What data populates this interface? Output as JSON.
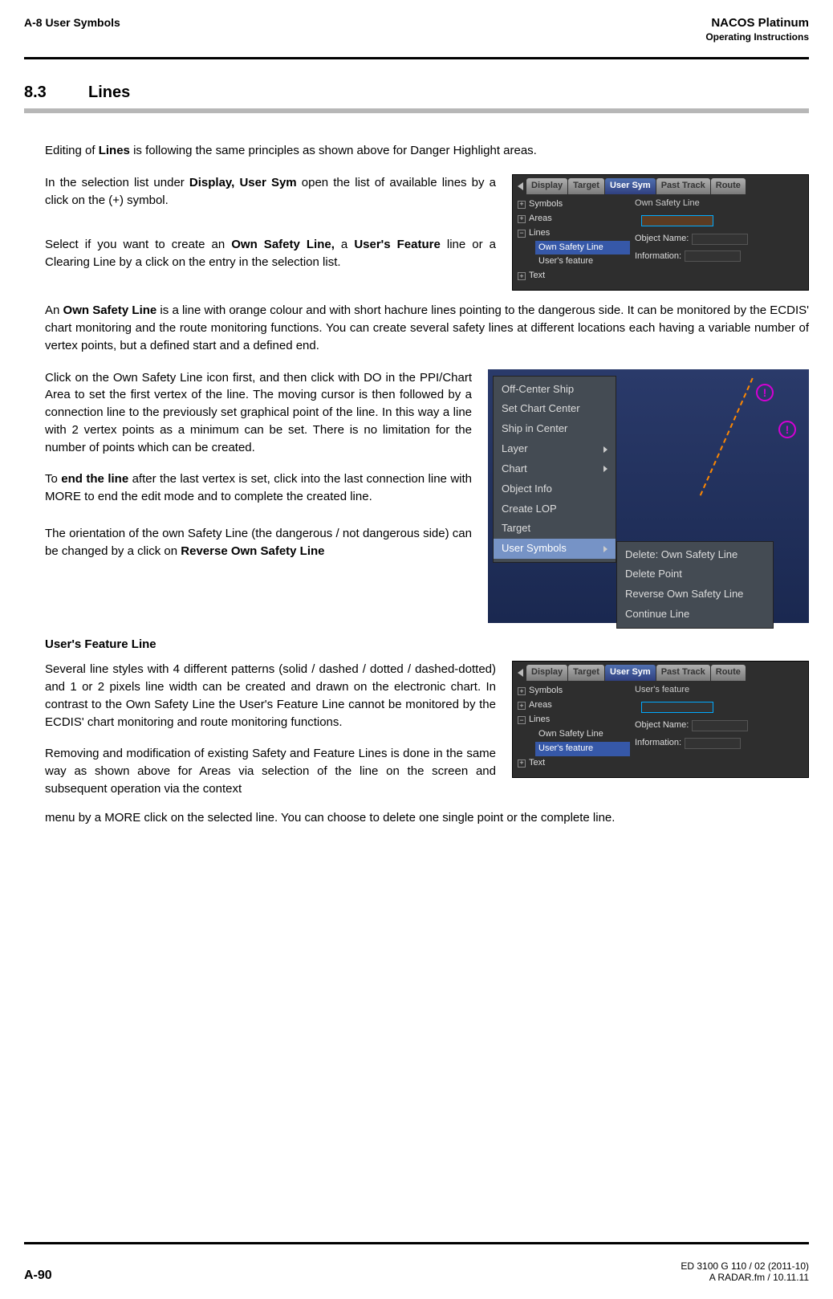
{
  "header": {
    "left": "A-8   User Symbols",
    "rightTitle": "NACOS Platinum",
    "rightSubtitle": "Operating Instructions"
  },
  "section": {
    "num": "8.3",
    "title": "Lines"
  },
  "intro": {
    "prefix": "Editing of ",
    "bold": "Lines",
    "suffix": " is following the same principles as shown above for Danger Highlight areas."
  },
  "p1": {
    "a": "In the selection list under ",
    "b": "Display, User Sym",
    "c": " open the list of available lines by a click on the (+) symbol."
  },
  "p2": {
    "a": "Select if you want to create an ",
    "b": "Own Safety Line,",
    "c": " a ",
    "d": "User's Feature",
    "e": " line or a Clearing Line by a click on the entry in the selection list."
  },
  "panel1": {
    "tabs": [
      "Display",
      "Target",
      "User Sym",
      "Past Track",
      "Route"
    ],
    "activeTab": 2,
    "tree": {
      "symbols": "Symbols",
      "areas": "Areas",
      "lines": "Lines",
      "lineSubs": [
        "Own Safety Line",
        "User's feature"
      ],
      "text": "Text"
    },
    "right": {
      "topLabel": "Own Safety Line",
      "objName": "Object Name:",
      "info": "Information:"
    }
  },
  "p3": {
    "a": "An ",
    "b": "Own Safety Line",
    "c": " is a line with orange colour and with short hachure lines pointing to the dangerous side. It can be monitored by the ECDIS' chart monitoring and the route monitoring functions. You can create several safety lines at different locations each having a variable number of vertex points, but a defined start and a defined end."
  },
  "p4": "Click on the Own Safety Line icon first, and then click with DO in the PPI/Chart Area to set the first vertex of the line. The moving cursor is then followed by a connection line to the previously set graphical point of the line. In this way a line with 2 vertex points as a minimum can be set. There is no limitation for the number of points which can be created.",
  "p5": {
    "a": "To ",
    "b": "end the line",
    "c": " after the last vertex is set, click into the last connection line with MORE to end the edit mode and to complete the created line."
  },
  "p6": {
    "a": "The orientation of the own Safety Line (the dangerous / not dangerous side) can be changed by a click on ",
    "b": "Reverse Own Safety Line"
  },
  "fig2": {
    "menu": [
      "Off-Center Ship",
      "Set Chart Center",
      "Ship in Center",
      "Layer",
      "Chart",
      "Object Info",
      "Create LOP",
      "Target",
      "User Symbols"
    ],
    "submenu": [
      "Delete: Own Safety Line",
      "Delete Point",
      "Reverse Own Safety Line",
      "Continue Line"
    ]
  },
  "sub1": "User's Feature Line",
  "p7": "Several line styles with 4 different patterns (solid / dashed / dotted / dashed-dotted) and 1 or 2 pixels line width can be created and drawn on the electronic chart. In contrast to the Own Safety Line the User's Feature Line cannot be monitored by the ECDIS' chart monitoring and route monitoring functions.",
  "p8": "Removing and modification of existing Safety and Feature Lines is done in the same way as shown above for Areas via selection of the line on the screen and subsequent operation via the context menu by a MORE click on the selected line. You can choose to delete one single point or the complete line.",
  "panel3": {
    "tabs": [
      "Display",
      "Target",
      "User Sym",
      "Past Track",
      "Route"
    ],
    "activeTab": 2,
    "tree": {
      "symbols": "Symbols",
      "areas": "Areas",
      "lines": "Lines",
      "lineSubs": [
        "Own Safety Line",
        "User's feature"
      ],
      "text": "Text"
    },
    "right": {
      "topLabel": "User's feature",
      "objName": "Object Name:",
      "info": "Information:"
    }
  },
  "footer": {
    "page": "A-90",
    "doc": "ED 3100 G 110 / 02 (2011-10)",
    "file": "A RADAR.fm / 10.11.11"
  }
}
